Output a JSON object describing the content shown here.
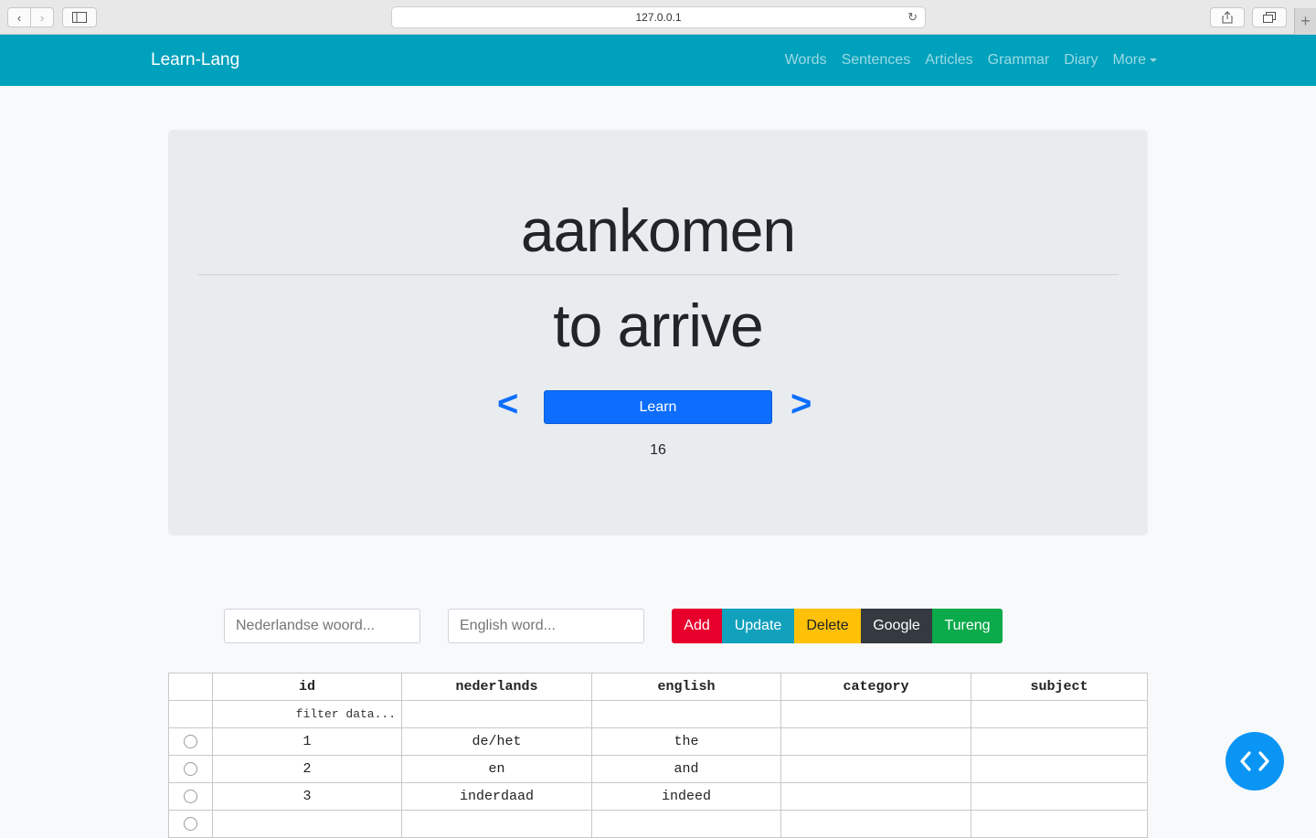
{
  "browser": {
    "url": "127.0.0.1"
  },
  "navbar": {
    "brand": "Learn-Lang",
    "links": [
      "Words",
      "Sentences",
      "Articles",
      "Grammar",
      "Diary",
      "More"
    ]
  },
  "card": {
    "word_nl": "aankomen",
    "word_en": "to arrive",
    "prev_label": "<",
    "next_label": ">",
    "learn_label": "Learn",
    "counter": "16"
  },
  "form": {
    "nl_placeholder": "Nederlandse woord...",
    "en_placeholder": "English word...",
    "add_label": "Add",
    "update_label": "Update",
    "delete_label": "Delete",
    "google_label": "Google",
    "tureng_label": "Tureng"
  },
  "table": {
    "headers": [
      "id",
      "nederlands",
      "english",
      "category",
      "subject"
    ],
    "filter_placeholder": "filter data...",
    "rows": [
      {
        "id": "1",
        "nederlands": "de/het",
        "english": "the",
        "category": "",
        "subject": ""
      },
      {
        "id": "2",
        "nederlands": "en",
        "english": "and",
        "category": "",
        "subject": ""
      },
      {
        "id": "3",
        "nederlands": "inderdaad",
        "english": "indeed",
        "category": "",
        "subject": ""
      }
    ]
  },
  "colors": {
    "navbar": "#00a1bc",
    "primary": "#0d6efd",
    "add": "#e8002d",
    "update": "#11a1bd",
    "delete": "#ffc107",
    "google": "#343a40",
    "tureng": "#0baa4a"
  }
}
